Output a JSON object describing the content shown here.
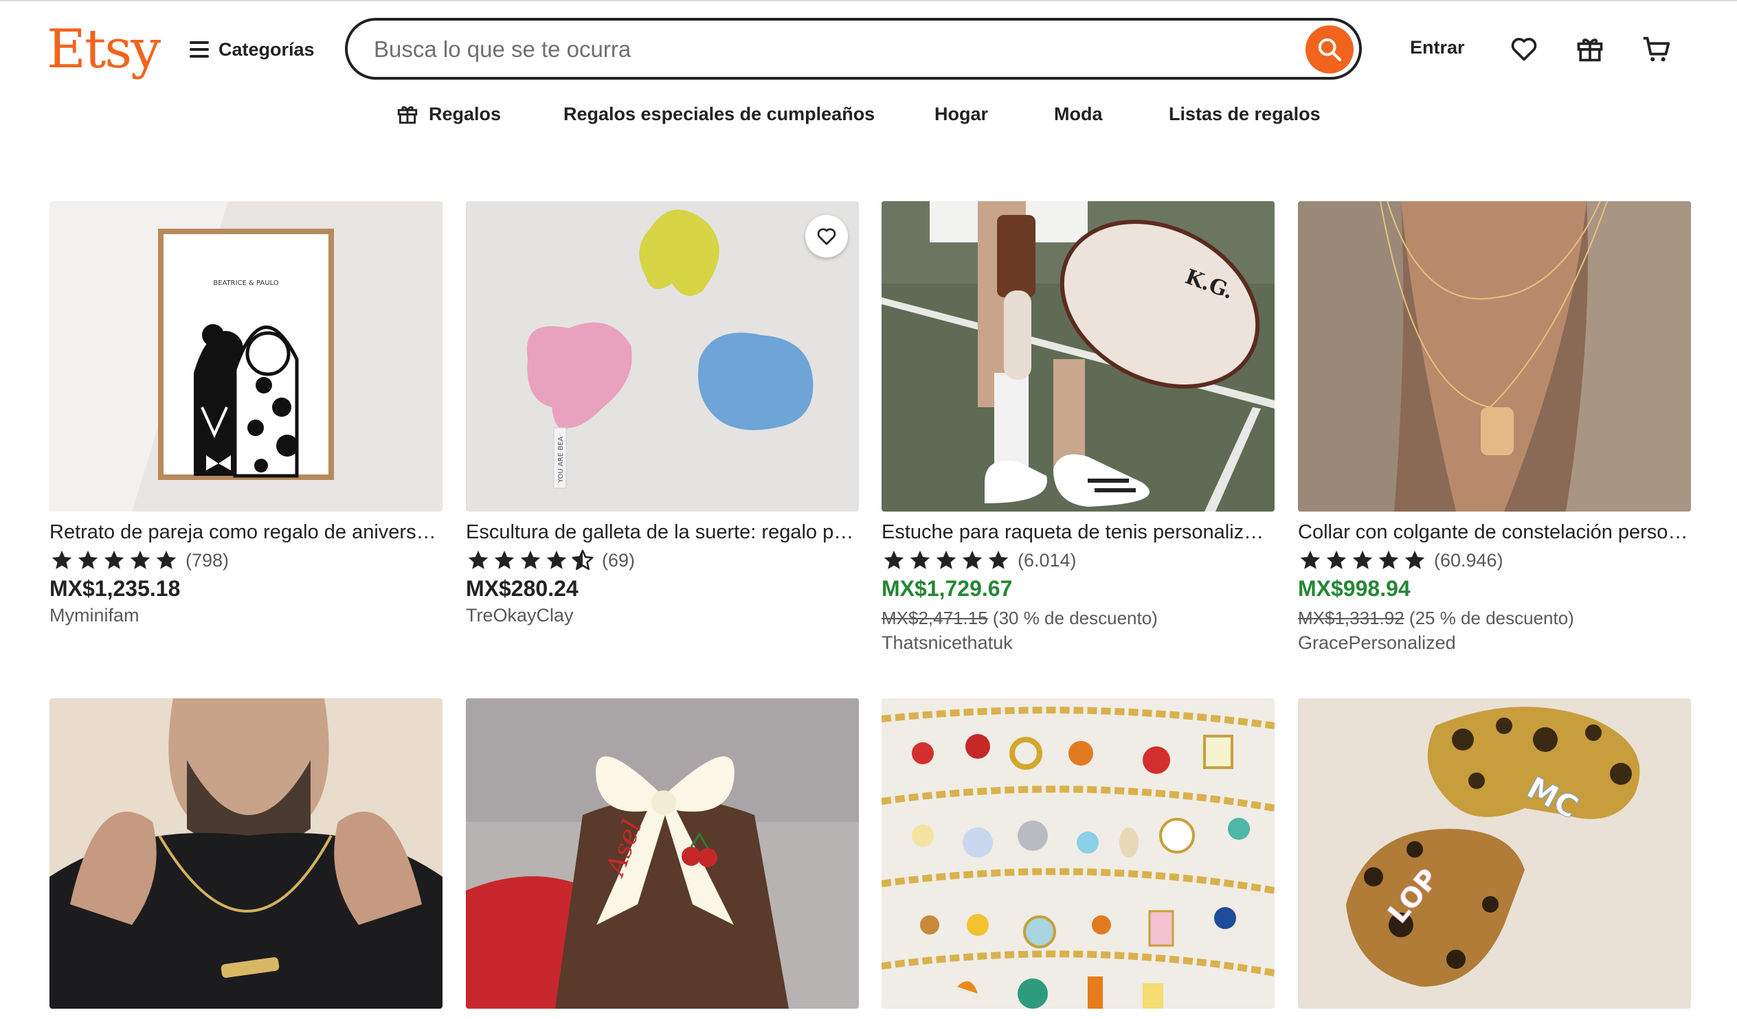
{
  "header": {
    "logo": "Etsy",
    "categories_label": "Categorías",
    "search_placeholder": "Busca lo que se te ocurra",
    "signin_label": "Entrar"
  },
  "subnav": [
    "Regalos",
    "Regalos especiales de cumpleaños",
    "Hogar",
    "Moda",
    "Listas de regalos"
  ],
  "colors": {
    "brand": "#f1641e",
    "sale_price": "#258635"
  },
  "products": [
    {
      "title": "Retrato de pareja como regalo de aniversario",
      "rating": 5,
      "reviews": "(798)",
      "price": "MX$1,235.18",
      "shop": "Myminifam"
    },
    {
      "title": "Escultura de galleta de la suerte: regalo personalizado",
      "rating": 4.5,
      "reviews": "(69)",
      "price": "MX$280.24",
      "shop": "TreOkayClay"
    },
    {
      "title": "Estuche para raqueta de tenis personalizado",
      "rating": 5,
      "reviews": "(6.014)",
      "price": "MX$1,729.67",
      "original_price": "MX$2,471.15",
      "discount": "(30 % de descuento)",
      "shop": "Thatsnicethatuk"
    },
    {
      "title": "Collar con colgante de constelación personalizado",
      "rating": 5,
      "reviews": "(60.946)",
      "price": "MX$998.94",
      "original_price": "MX$1,331.92",
      "discount": "(25 % de descuento)",
      "shop": "GracePersonalized"
    }
  ],
  "images": {
    "portrait_print_text": "BEATRICE & PAULO",
    "fortune_tag_text": "YOU ARE BEA",
    "racket_case_text": "K.G.",
    "bow_text": "Asel",
    "claw_clip_text_1": "MC",
    "claw_clip_text_2": "LOP"
  }
}
